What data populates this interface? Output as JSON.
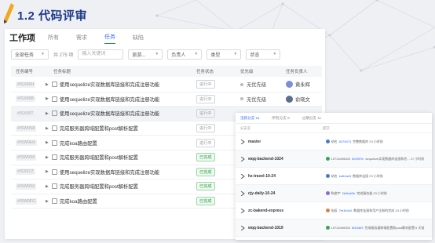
{
  "header": {
    "title": "1.2 代码评审"
  },
  "colors": {
    "accent": "#2f6df6",
    "title": "#1e3a8a",
    "done": "#2e9d48"
  },
  "panel": {
    "page_title": "工作项",
    "tabs": [
      {
        "label": "所有"
      },
      {
        "label": "需求"
      },
      {
        "label": "任务"
      },
      {
        "label": "缺陷"
      }
    ],
    "active_tab": "任务",
    "filters": {
      "all_tasks": "全部任务",
      "count": "共 275 项",
      "search_placeholder": "输入关键词",
      "iteration": "旅游...",
      "owner": "负责人",
      "type": "类型",
      "state": "状态"
    },
    "columns": {
      "id": "任务编号",
      "title": "任务标题",
      "status": "任务状态",
      "priority": "优先级",
      "owner": "任务负责人"
    },
    "rows": [
      {
        "id": "#ISX99H",
        "title": "使用sequelize实现数据库链接和完成注册功能",
        "status": "进行中",
        "done": false,
        "priority": "无优先级",
        "owner": "黄永辉",
        "highlight": false
      },
      {
        "id": "#ISX99B",
        "title": "使用sequelize实现数据库链接和完成注册功能",
        "status": "进行中",
        "done": false,
        "priority": "无优先级",
        "owner": "俞晓文",
        "highlight": false
      },
      {
        "id": "#ISX99T",
        "title": "使用sequelize实现数据库链接和完成注册功能",
        "status": "进行中",
        "done": false,
        "priority": "",
        "owner": "",
        "highlight": true
      },
      {
        "id": "#ISW0S8",
        "title": "完成服务器跨域配置和post解析配置",
        "status": "进行中",
        "done": false,
        "priority": "",
        "owner": "",
        "highlight": false
      },
      {
        "id": "#ISW0H4",
        "title": "完成koa路由配置",
        "status": "进行中",
        "done": false,
        "priority": "",
        "owner": "",
        "highlight": false
      },
      {
        "id": "#ISW0S6",
        "title": "完成服务器跨域配置和post解析配置",
        "status": "已完成",
        "done": true,
        "priority": "",
        "owner": "",
        "highlight": false
      },
      {
        "id": "#ISX97Z",
        "title": "使用sequelize实现数据库链接和完成注册功能",
        "status": "已完成",
        "done": true,
        "priority": "",
        "owner": "",
        "highlight": false
      },
      {
        "id": "#ISW0S0",
        "title": "完成服务器跨域配置和post解析配置",
        "status": "已完成",
        "done": true,
        "priority": "",
        "owner": "",
        "highlight": false
      },
      {
        "id": "#ISW0FG",
        "title": "完成koa路由配置",
        "status": "已完成",
        "done": true,
        "priority": "",
        "owner": "",
        "highlight": false
      }
    ]
  },
  "branches": {
    "tabs": [
      {
        "label": "活跃分支 11"
      },
      {
        "label": "所有分支 8"
      },
      {
        "label": "过期分支 11"
      }
    ],
    "active_tab": "活跃分支 11",
    "header": {
      "branch": "分支名",
      "commit": "提交"
    },
    "items": [
      {
        "name": "master",
        "author": "胡名",
        "hash": "5079473",
        "message": "完整数据库 23 小时前",
        "avatar": "#4a78c9"
      },
      {
        "name": "wqq-backend-1024",
        "author": "15734496600",
        "hash": "0b09f7fc",
        "message": "sequelize实现数据库连接和完... 17 小时前",
        "avatar": "#3aa55a"
      },
      {
        "name": "hz-travel-10-24",
        "author": "胡名",
        "hash": "ea54ab3",
        "message": "数据库连接 23 小时前",
        "avatar": "#4a78c9"
      },
      {
        "name": "cjy-daily-10-24",
        "author": "陈俊宇",
        "hash": "2b0fa62b",
        "message": "完成服务器 23 小时前",
        "avatar": "#8a6bd1"
      },
      {
        "name": "zc-bakend-express",
        "author": "张辰",
        "hash": "7fe36444",
        "message": "数据库连接和用户注册的完成 23 小时前",
        "avatar": "#c98a4a"
      },
      {
        "name": "wqq-backend-1019",
        "author": "15734496500",
        "hash": "6f40d09",
        "message": "完成服务器跨域配置和post解析配置 6 天前",
        "avatar": "#3aa55a"
      }
    ]
  }
}
